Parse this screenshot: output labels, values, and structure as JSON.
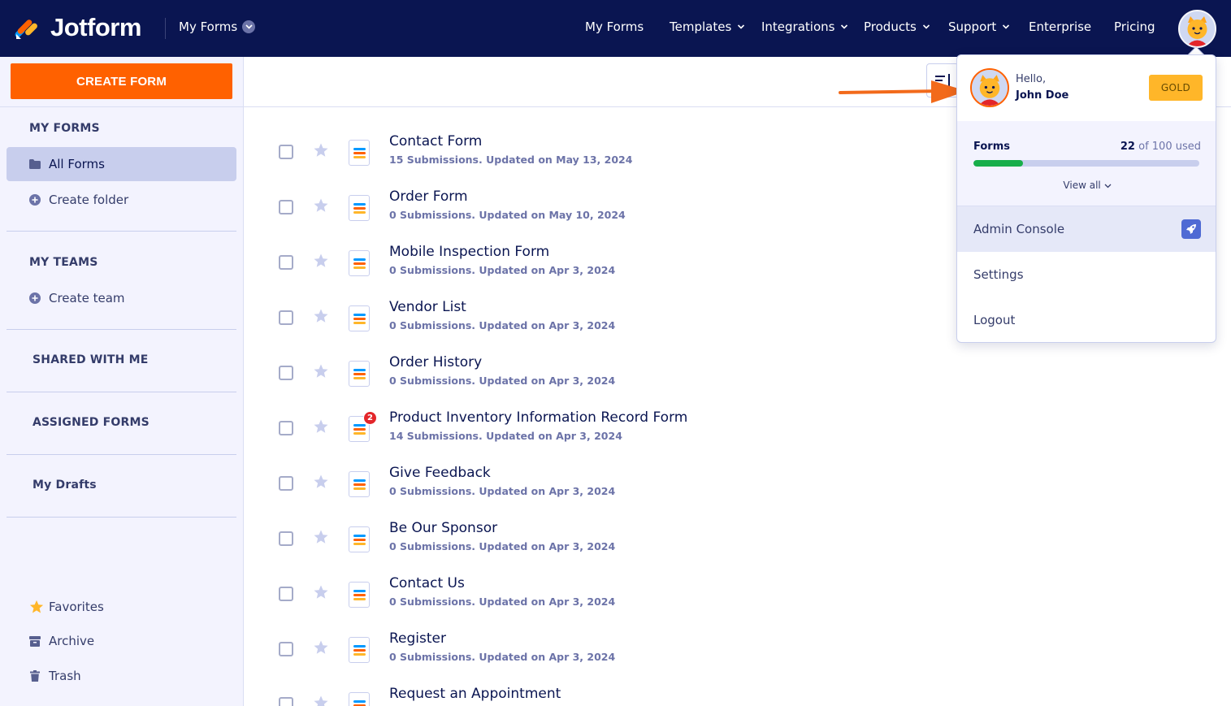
{
  "topbar": {
    "logo_text": "Jotform",
    "crumb": "My Forms",
    "nav": [
      {
        "label": "My Forms",
        "has_dropdown": false
      },
      {
        "label": "Templates",
        "has_dropdown": true
      },
      {
        "label": "Integrations",
        "has_dropdown": true
      },
      {
        "label": "Products",
        "has_dropdown": true
      },
      {
        "label": "Support",
        "has_dropdown": true
      },
      {
        "label": "Enterprise",
        "has_dropdown": false
      },
      {
        "label": "Pricing",
        "has_dropdown": false
      }
    ]
  },
  "sidebar": {
    "create_label": "CREATE FORM",
    "my_forms_heading": "MY FORMS",
    "all_forms": "All Forms",
    "create_folder": "Create folder",
    "my_teams_heading": "MY TEAMS",
    "create_team": "Create team",
    "shared_with_me": "SHARED WITH ME",
    "assigned_forms": "ASSIGNED FORMS",
    "my_drafts": "My Drafts",
    "favorites": "Favorites",
    "archive": "Archive",
    "trash": "Trash"
  },
  "forms": [
    {
      "title": "Contact Form",
      "subtitle": "15 Submissions. Updated on May 13, 2024",
      "badge": ""
    },
    {
      "title": "Order Form",
      "subtitle": "0 Submissions. Updated on May 10, 2024",
      "badge": ""
    },
    {
      "title": "Mobile Inspection Form",
      "subtitle": "0 Submissions. Updated on Apr 3, 2024",
      "badge": ""
    },
    {
      "title": "Vendor List",
      "subtitle": "0 Submissions. Updated on Apr 3, 2024",
      "badge": ""
    },
    {
      "title": "Order History",
      "subtitle": "0 Submissions. Updated on Apr 3, 2024",
      "badge": ""
    },
    {
      "title": "Product Inventory Information Record Form",
      "subtitle": "14 Submissions. Updated on Apr 3, 2024",
      "badge": "2"
    },
    {
      "title": "Give Feedback",
      "subtitle": "0 Submissions. Updated on Apr 3, 2024",
      "badge": ""
    },
    {
      "title": "Be Our Sponsor",
      "subtitle": "0 Submissions. Updated on Apr 3, 2024",
      "badge": ""
    },
    {
      "title": "Contact Us",
      "subtitle": "0 Submissions. Updated on Apr 3, 2024",
      "badge": ""
    },
    {
      "title": "Register",
      "subtitle": "0 Submissions. Updated on Apr 3, 2024",
      "badge": ""
    },
    {
      "title": "Request an Appointment",
      "subtitle": "",
      "badge": ""
    }
  ],
  "account_menu": {
    "hello": "Hello,",
    "name": "John Doe",
    "plan": "GOLD",
    "usage_label": "Forms",
    "usage_used": "22",
    "usage_rest": "of 100 used",
    "usage_fraction": 0.22,
    "view_all": "View all",
    "admin_console": "Admin Console",
    "settings": "Settings",
    "logout": "Logout"
  },
  "colors": {
    "navy": "#0a1551",
    "orange": "#ff6100",
    "gold": "#ffb629",
    "green": "#18ae4a"
  }
}
